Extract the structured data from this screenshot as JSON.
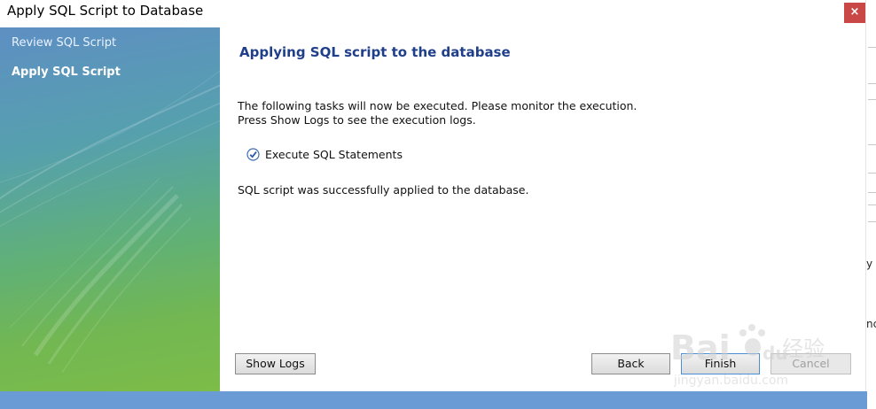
{
  "window": {
    "title": "Apply SQL Script to Database",
    "close_glyph": "×"
  },
  "sidebar": {
    "items": [
      {
        "label": "Review SQL Script",
        "active": false
      },
      {
        "label": "Apply SQL Script",
        "active": true
      }
    ]
  },
  "main": {
    "heading": "Applying SQL script to the database",
    "info_line1": "The following tasks will now be executed. Please monitor the execution.",
    "info_line2": "Press Show Logs to see the execution logs.",
    "task": {
      "label": "Execute SQL Statements",
      "status": "done",
      "icon": "check-circle-icon"
    },
    "result": "SQL script was successfully applied to the database."
  },
  "buttons": {
    "show_logs": "Show Logs",
    "back": "Back",
    "finish": "Finish",
    "cancel": "Cancel"
  },
  "background_window": {
    "chars": [
      "y",
      "nc"
    ]
  },
  "watermark": {
    "brand": "Bai",
    "brand2": "du",
    "cn": "经验",
    "url": "jingyan.baidu.com"
  },
  "colors": {
    "heading": "#1f3f8a",
    "close": "#c94744",
    "strip": "#6a9bd4",
    "accent": "#4a8ed4"
  }
}
